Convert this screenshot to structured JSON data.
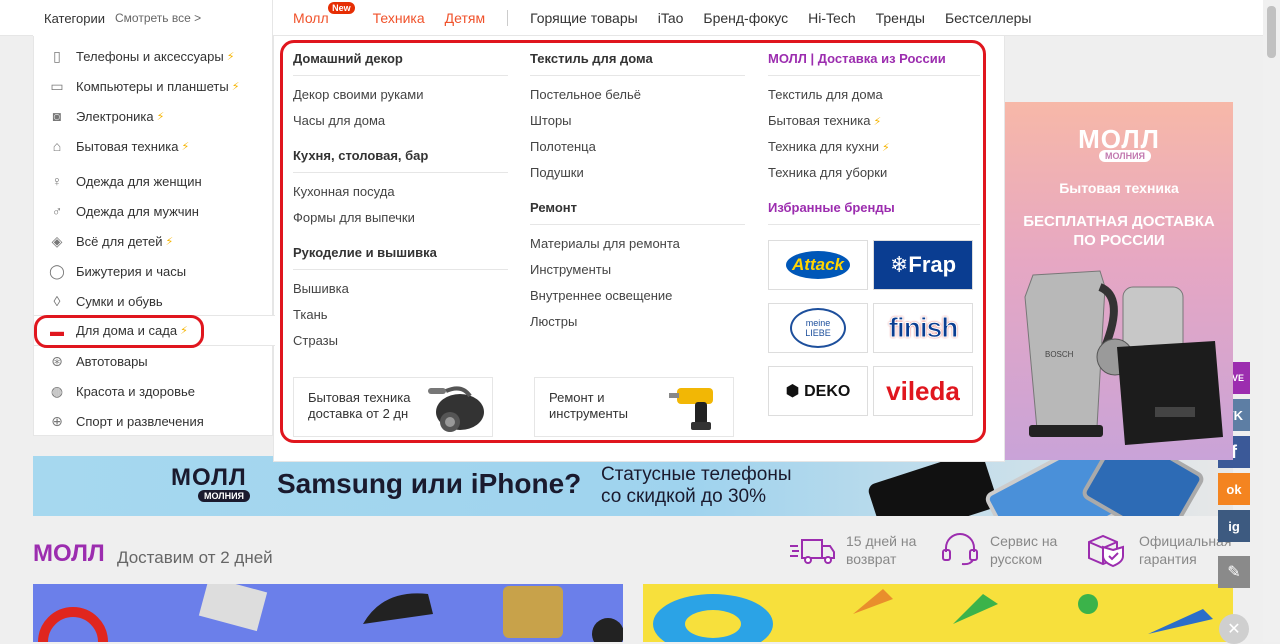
{
  "header": {
    "categories_label": "Категории",
    "see_all": "Смотреть все >",
    "nav": [
      {
        "label": "Молл",
        "badge": "New"
      },
      {
        "label": "Техника"
      },
      {
        "label": "Детям"
      },
      {
        "label": "Горящие товары"
      },
      {
        "label": "iTao"
      },
      {
        "label": "Бренд-фокус"
      },
      {
        "label": "Hi-Tech"
      },
      {
        "label": "Тренды"
      },
      {
        "label": "Бестселлеры"
      }
    ]
  },
  "sidebar": {
    "items": [
      {
        "label": "Телефоны и аксессуары",
        "icon": "phone-icon"
      },
      {
        "label": "Компьютеры и планшеты",
        "icon": "laptop-icon"
      },
      {
        "label": "Электроника",
        "icon": "camera-icon"
      },
      {
        "label": "Бытовая техника",
        "icon": "iron-icon"
      },
      {
        "label": "Одежда для женщин",
        "icon": "dress-icon"
      },
      {
        "label": "Одежда для мужчин",
        "icon": "shirt-icon"
      },
      {
        "label": "Всё для детей",
        "icon": "bottle-icon"
      },
      {
        "label": "Бижутерия и часы",
        "icon": "ring-icon"
      },
      {
        "label": "Сумки и обувь",
        "icon": "bag-icon"
      },
      {
        "label": "Для дома и сада",
        "icon": "sofa-icon"
      },
      {
        "label": "Автотовары",
        "icon": "wheel-icon"
      },
      {
        "label": "Красота и здоровье",
        "icon": "bulb-icon"
      },
      {
        "label": "Спорт и развлечения",
        "icon": "ball-icon"
      }
    ]
  },
  "mega": {
    "col1": {
      "groups": [
        {
          "heading": "Домашний декор",
          "links": [
            "Декор своими руками",
            "Часы для дома"
          ]
        },
        {
          "heading": "Кухня, столовая, бар",
          "links": [
            "Кухонная посуда",
            "Формы для выпечки"
          ]
        },
        {
          "heading": "Рукоделие и вышивка",
          "links": [
            "Вышивка",
            "Ткань",
            "Стразы"
          ]
        }
      ],
      "promo": "Бытовая техника доставка от 2 дн"
    },
    "col2": {
      "groups": [
        {
          "heading": "Текстиль для дома",
          "links": [
            "Постельное бельё",
            "Шторы",
            "Полотенца",
            "Подушки"
          ]
        },
        {
          "heading": "Ремонт",
          "links": [
            "Материалы для ремонта",
            "Инструменты",
            "Внутреннее освещение",
            "Люстры"
          ]
        }
      ],
      "promo": "Ремонт и инструменты"
    },
    "col3": {
      "heading": "МОЛЛ | Доставка из России",
      "links": [
        "Текстиль для дома",
        "Бытовая техника",
        "Техника для кухни",
        "Техника для уборки"
      ],
      "brands_heading": "Избранные бренды",
      "brands": [
        "Attack",
        "Frap",
        "meine LIEBE",
        "finish",
        "DEKO",
        "vileda"
      ]
    }
  },
  "banner_right": {
    "logo": "МОЛЛ",
    "badge": "МОЛНИЯ",
    "title": "Бытовая техника",
    "subtitle": "БЕСПЛАТНАЯ ДОСТАВКА ПО РОССИИ",
    "appliance_brand": "BOSCH",
    "bg_colors": [
      "#f7b8a8",
      "#c9a3d8"
    ]
  },
  "bottom_banner": {
    "logo": "МОЛЛ",
    "badge": "МОЛНИЯ",
    "headline": "Samsung или iPhone?",
    "sub_line1": "Статусные телефоны",
    "sub_line2": "со скидкой до 30%"
  },
  "mall": {
    "title": "МОЛЛ",
    "subtitle": "Доставим от 2 дней",
    "features": [
      {
        "line1": "15 дней на",
        "line2": "возврат",
        "icon": "truck-icon"
      },
      {
        "line1": "Сервис на",
        "line2": "русском",
        "icon": "headset-icon"
      },
      {
        "line1": "Официальная",
        "line2": "гарантия",
        "icon": "shield-box-icon"
      }
    ]
  },
  "social": [
    {
      "label": "LIVE",
      "icon": "live-icon",
      "color": "#9c2daf"
    },
    {
      "label": "VK",
      "icon": "vk-icon",
      "color": "#5d7ea4"
    },
    {
      "label": "f",
      "icon": "facebook-icon",
      "color": "#3b5998"
    },
    {
      "label": "ok",
      "icon": "odnoklassniki-icon",
      "color": "#f48420"
    },
    {
      "label": "ig",
      "icon": "instagram-icon",
      "color": "#3d5a80"
    },
    {
      "label": "✎",
      "icon": "pencil-icon",
      "color": "#8a8a8a"
    }
  ],
  "colors": {
    "accent": "#f0522b",
    "highlight": "#e0161e",
    "mall": "#9c2daf",
    "bolt": "#f5b400"
  }
}
